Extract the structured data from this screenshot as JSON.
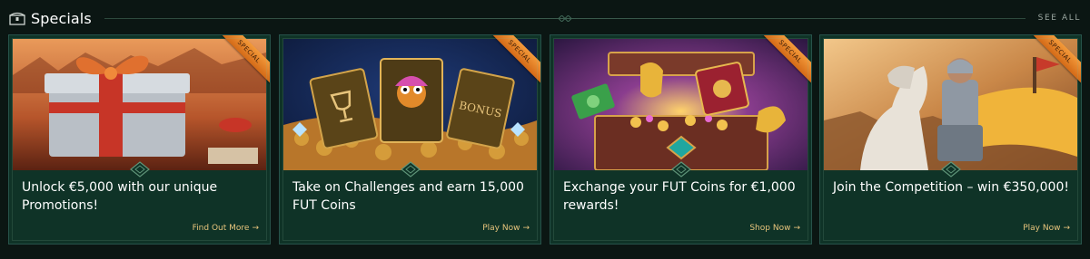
{
  "header": {
    "title": "Specials",
    "see_all": "SEE ALL",
    "icon": "chest-icon"
  },
  "colors": {
    "background": "#0b1613",
    "card_bg": "#0f3327",
    "link": "#e7c47c",
    "ribbon": "#f39a3a"
  },
  "cards": [
    {
      "ribbon": "SPECIAL",
      "text": "Unlock €5,000 with our unique Promotions!",
      "link": "Find Out More",
      "image": "gift-box-image"
    },
    {
      "ribbon": "SPECIAL",
      "text": "Take on Challenges and earn 15,000 FUT Coins",
      "link": "Play Now",
      "image": "challenge-cards-image"
    },
    {
      "ribbon": "SPECIAL",
      "text": "Exchange your FUT Coins for €1,000 rewards!",
      "link": "Shop Now",
      "image": "treasure-chest-image"
    },
    {
      "ribbon": "SPECIAL",
      "text": "Join the Competition – win €350,000!",
      "link": "Play Now",
      "image": "knight-image"
    }
  ]
}
